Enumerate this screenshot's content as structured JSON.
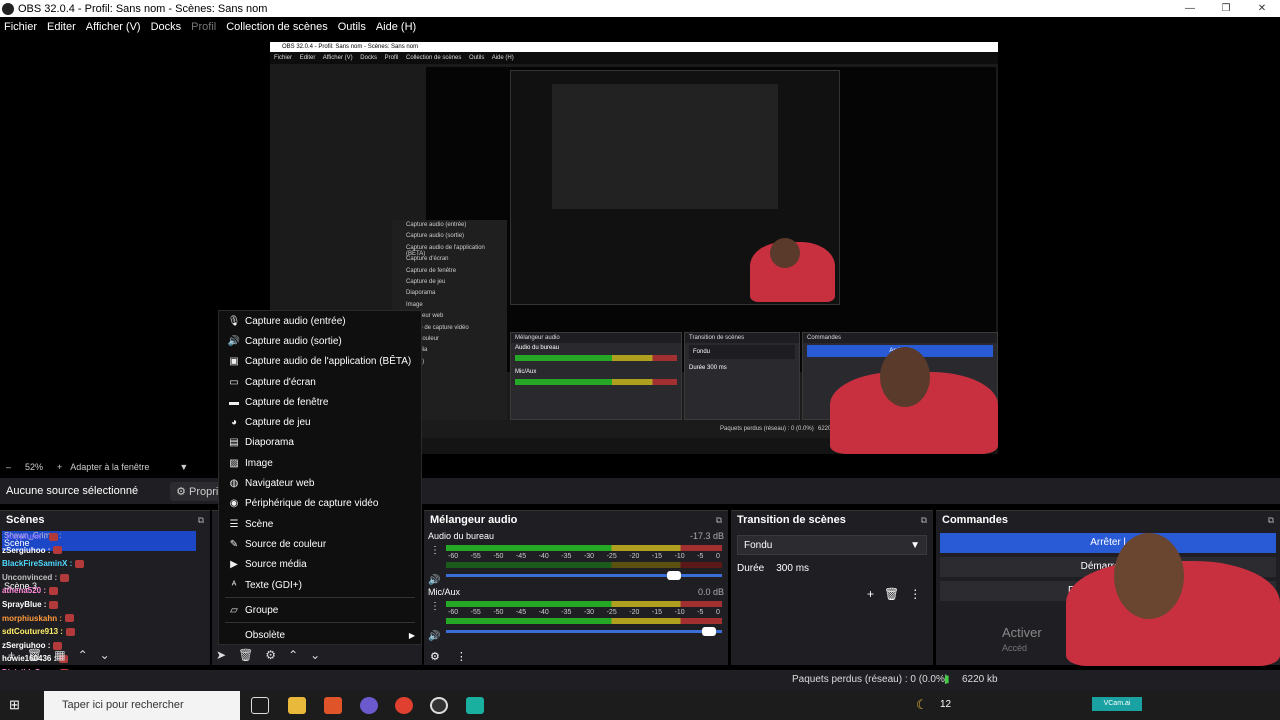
{
  "window": {
    "title": "OBS 32.0.4 - Profil: Sans nom - Scènes: Sans nom"
  },
  "menu": [
    "Fichier",
    "Editer",
    "Afficher (V)",
    "Docks",
    "Profil",
    "Collection de scènes",
    "Outils",
    "Aide (H)"
  ],
  "preview": {
    "nested_title": "OBS 32.0.4 - Profil: Sans nom - Scènes: Sans nom",
    "nested_menu": [
      "Fichier",
      "Editer",
      "Afficher (V)",
      "Docks",
      "Profil",
      "Collection de scènes",
      "Outils",
      "Aide (H)"
    ],
    "nested_mixer": "Mélangeur audio",
    "nested_transition": "Transition de scènes",
    "nested_commands": "Commandes",
    "nested_audio_desktop": "Audio du bureau",
    "nested_micaux": "Mic/Aux",
    "nested_fondu": "Fondu",
    "nested_duree": "Durée",
    "nested_duree_val": "300 ms",
    "nested_stop": "Arrêter l",
    "nested_demarrer": "Démarrer l'e",
    "nested_camera": "Démarrer la camé",
    "nested_loss": "Paquets perdus (réseau) : 0 (0.0%)",
    "nested_kb": "6220 k",
    "nested_menu_items": [
      "Capture audio (entrée)",
      "Capture audio (sortie)",
      "Capture audio de l'application (BÊTA)",
      "Capture d'écran",
      "Capture de fenêtre",
      "Capture de jeu",
      "Diaporama",
      "Image",
      "avigateur web",
      "érique de capture vidéo",
      "e de couleur",
      "e média",
      "(GDI+)",
      "ire"
    ]
  },
  "statusbar": {
    "zoom": "52%",
    "fit": "Adapter à la fenêtre"
  },
  "sources": {
    "none_selected": "Aucune source sélectionné",
    "properties": "Propriét"
  },
  "scenes": {
    "title": "Scènes",
    "selected": "Scène",
    "selected_overlay": "Shawn_Grimm :",
    "item2": "Scène 3"
  },
  "chat": [
    {
      "name": "_Kerplunk :",
      "color": "#7b6cff"
    },
    {
      "name": "zSergiuhoo :",
      "color": "#ffffff"
    },
    {
      "name": "BlackFireSaminX :",
      "color": "#4fd8ff"
    },
    {
      "name": "Unconvinced :",
      "color": "#c0c0c0"
    },
    {
      "name": "athena520 :",
      "color": "#ff8ad8"
    },
    {
      "name": "SprayBlue :",
      "color": "#ffffff"
    },
    {
      "name": "morphiuskahn :",
      "color": "#ff9a3c"
    },
    {
      "name": "sdtCouture913 :",
      "color": "#ffee66"
    },
    {
      "name": "zSergiuhoo :",
      "color": "#ffffff"
    },
    {
      "name": "howie160436 :",
      "color": "#ffffff"
    },
    {
      "name": "DivisibleSum :",
      "color": "#ff8ad8"
    },
    {
      "name": "Drose_13 :",
      "color": "#c0c0c0"
    }
  ],
  "context_menu": [
    {
      "label": "Capture audio (entrée)",
      "icon": "mic-icon"
    },
    {
      "label": "Capture audio (sortie)",
      "icon": "speaker-icon"
    },
    {
      "label": "Capture audio de l'application (BÊTA)",
      "icon": "app-audio-icon"
    },
    {
      "label": "Capture d'écran",
      "icon": "monitor-icon"
    },
    {
      "label": "Capture de fenêtre",
      "icon": "window-icon"
    },
    {
      "label": "Capture de jeu",
      "icon": "gamepad-icon"
    },
    {
      "label": "Diaporama",
      "icon": "slideshow-icon"
    },
    {
      "label": "Image",
      "icon": "image-icon"
    },
    {
      "label": "Navigateur web",
      "icon": "globe-icon"
    },
    {
      "label": "Périphérique de capture vidéo",
      "icon": "camera-icon"
    },
    {
      "label": "Scène",
      "icon": "list-icon"
    },
    {
      "label": "Source de couleur",
      "icon": "brush-icon"
    },
    {
      "label": "Source média",
      "icon": "play-icon"
    },
    {
      "label": "Texte (GDI+)",
      "icon": "text-icon"
    },
    {
      "label": "Groupe",
      "icon": "folder-icon"
    },
    {
      "label": "Obsolète",
      "icon": "none"
    }
  ],
  "mixer": {
    "title": "Mélangeur audio",
    "channels": [
      {
        "name": "Audio du bureau",
        "db": "-17.3 dB",
        "level": 0.62,
        "volume": 0.85
      },
      {
        "name": "Mic/Aux",
        "db": "0.0 dB",
        "level": 0.72,
        "volume": 0.98
      }
    ],
    "ticks": [
      "-60",
      "-55",
      "-50",
      "-45",
      "-40",
      "-35",
      "-30",
      "-25",
      "-20",
      "-15",
      "-10",
      "-5",
      "0"
    ]
  },
  "transition": {
    "title": "Transition de scènes",
    "type": "Fondu",
    "duration_label": "Durée",
    "duration_value": "300 ms"
  },
  "commands": {
    "title": "Commandes",
    "stop": "Arrêter l",
    "start_rec": "Démarrer l'e",
    "start_cam": "Démarrer la camé",
    "watermark": "Activer",
    "watermark2": "Accéd"
  },
  "status": {
    "dropped": "Paquets perdus (réseau) : 0 (0.0%)",
    "bitrate": "6220 kb"
  },
  "taskbar": {
    "search": "Taper ici pour rechercher",
    "time": "12",
    "cam_label": "VCam.ai"
  }
}
